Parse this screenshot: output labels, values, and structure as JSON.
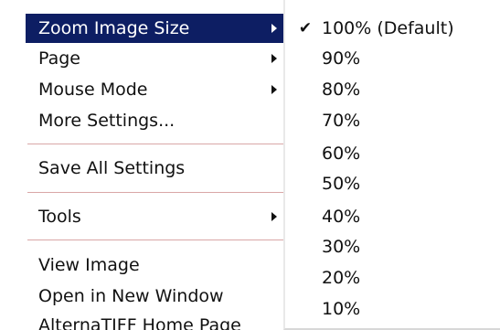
{
  "menu": {
    "items": [
      {
        "label": "Zoom Image Size",
        "has_submenu": true
      },
      {
        "label": "Page",
        "has_submenu": true
      },
      {
        "label": "Mouse Mode",
        "has_submenu": true
      },
      {
        "label": "More Settings..."
      },
      {
        "label": "Save All Settings"
      },
      {
        "label": "Tools",
        "has_submenu": true
      },
      {
        "label": "View Image"
      },
      {
        "label": "Open in New Window"
      },
      {
        "label": "AlternaTIFF Home Page"
      }
    ]
  },
  "submenu": {
    "checkmark": "✔",
    "items": [
      {
        "label": "100% (Default)",
        "checked": true
      },
      {
        "label": "90%"
      },
      {
        "label": "80%"
      },
      {
        "label": "70%"
      },
      {
        "label": "60%"
      },
      {
        "label": "50%"
      },
      {
        "label": "40%"
      },
      {
        "label": "30%"
      },
      {
        "label": "20%"
      },
      {
        "label": "10%"
      }
    ]
  },
  "colors": {
    "highlight_background": "#0d1e63",
    "highlight_text": "#ffffff",
    "separator": "#d9a7a7"
  }
}
